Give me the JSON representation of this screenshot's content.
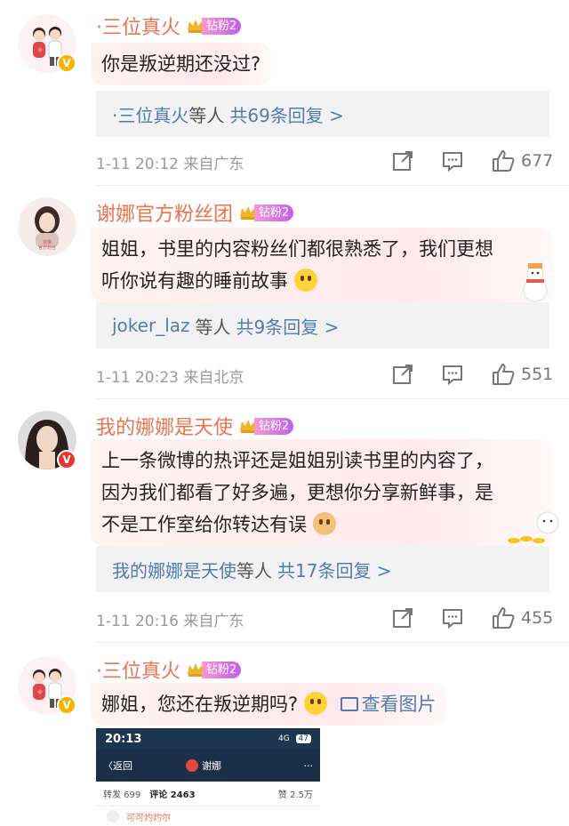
{
  "comments": [
    {
      "username": "·三位真火",
      "level": "钻粉2",
      "text": "你是叛逆期还没过?",
      "replies": {
        "who": "·三位真火",
        "deng": "等人",
        "count": "共69条回复 >"
      },
      "time": "1-11 20:12",
      "source": "来自广东",
      "likes": "677"
    },
    {
      "username": "谢娜官方粉丝团",
      "level": "钻粉2",
      "text_line1": "姐姐，书里的内容粉丝们都很熟悉了，我们更想",
      "text_line2": "听你说有趣的睡前故事",
      "replies": {
        "who": "joker_laz",
        "deng": "等人",
        "count": "共9条回复 >"
      },
      "time": "1-11 20:23",
      "source": "来自北京",
      "likes": "551"
    },
    {
      "username": "我的娜娜是天使",
      "level": "钻粉2",
      "text_line1": "上一条微博的热评还是姐姐别读书里的内容了，",
      "text_line2": "因为我们都看了好多遍，更想你分享新鲜事，是",
      "text_line3": "不是工作室给你转达有误",
      "replies": {
        "who": "我的娜娜是天使",
        "deng": "等人",
        "count": "共17条回复 >"
      },
      "time": "1-11 20:16",
      "source": "来自广东",
      "likes": "455"
    },
    {
      "username": "·三位真火",
      "level": "钻粉2",
      "text": "娜姐，您还在叛逆期吗?",
      "image_link": "查看图片"
    }
  ],
  "thumbnail": {
    "time": "20:13",
    "signal": "4G",
    "battery": "47",
    "back": "〈返回",
    "title": "谢娜",
    "reposts": "转发 699",
    "comments": "评论 2463",
    "likes": "赞 2.5万",
    "first_user": "可可灼灼尔"
  },
  "colors": {
    "username": "#eb7350",
    "link": "#507daf",
    "meta": "#9a9a9a"
  }
}
